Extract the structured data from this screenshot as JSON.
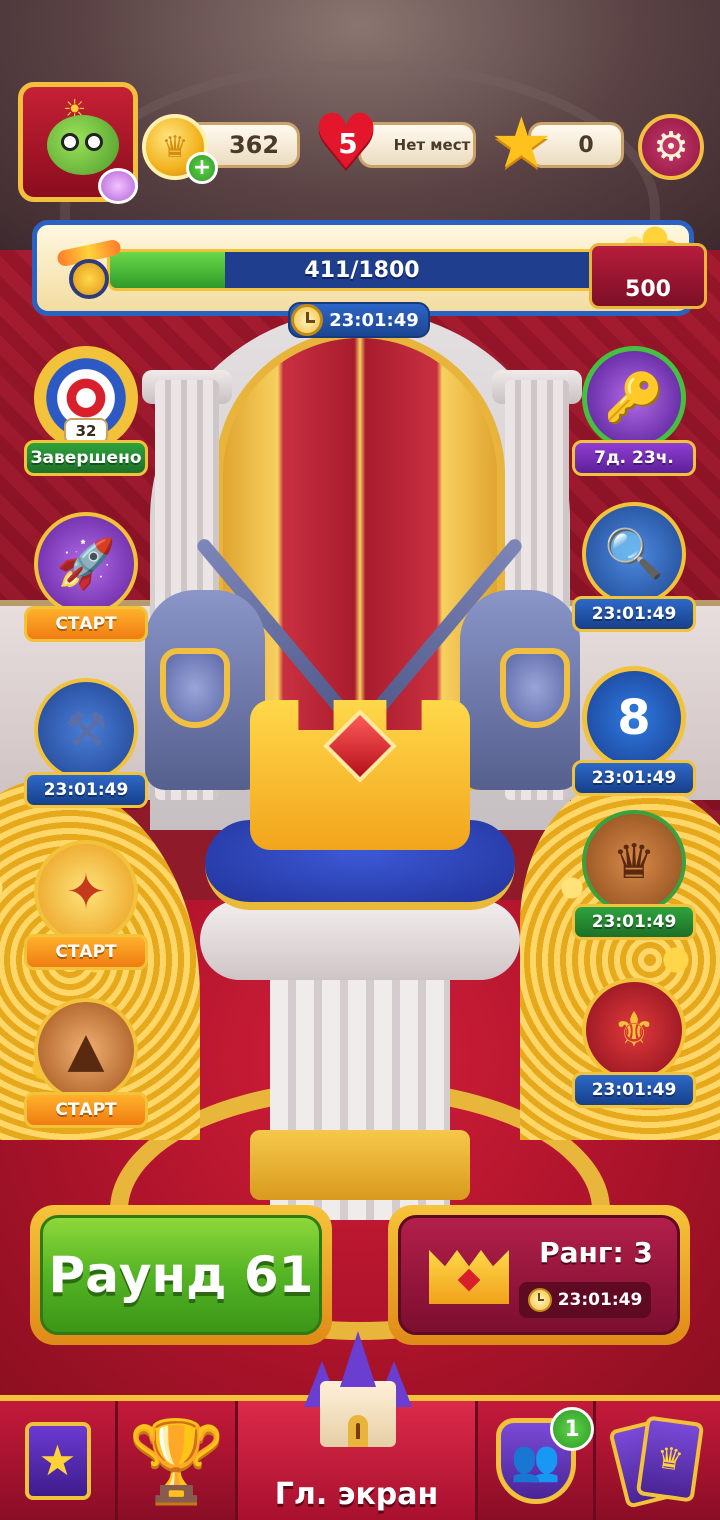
{
  "hud": {
    "coins": "362",
    "lives": "5",
    "lives_status": "Нет мест",
    "stars": "0",
    "coin_plus": "+",
    "settings_icon": "gear-icon"
  },
  "progress": {
    "text": "411/1800",
    "current": 411,
    "max": 1800,
    "reward": "500",
    "timer": "23:01:49"
  },
  "events_left": [
    {
      "id": "target",
      "label": "Завершено",
      "count": "32",
      "icon": "target-icon"
    },
    {
      "id": "rocket",
      "label": "СТАРТ",
      "icon": "rocket-icon"
    },
    {
      "id": "anvil",
      "label": "23:01:49",
      "icon": "anvil-icon"
    },
    {
      "id": "arch",
      "label": "СТАРТ",
      "icon": "golden-arch-icon"
    },
    {
      "id": "volcano",
      "label": "СТАРТ",
      "icon": "volcano-icon"
    }
  ],
  "events_right": [
    {
      "id": "key",
      "label": "7д. 23ч.",
      "icon": "key-icon"
    },
    {
      "id": "scroll",
      "label": "23:01:49",
      "icon": "magnifier-scroll-icon"
    },
    {
      "id": "shield",
      "label": "23:01:49",
      "value": "8",
      "icon": "shield-icon"
    },
    {
      "id": "chest",
      "label": "23:01:49",
      "icon": "chest-icon"
    },
    {
      "id": "crate",
      "label": "23:01:49",
      "icon": "crate-icon"
    }
  ],
  "play_button": {
    "label": "Раунд 61"
  },
  "rank_button": {
    "title": "Ранг: 3",
    "timer": "23:01:49"
  },
  "nav": {
    "home_label": "Гл. экран",
    "team_badge": "1"
  },
  "colors": {
    "accent_gold": "#f2c23a",
    "play_green": "#54b424",
    "nav_red": "#c41a3a",
    "banner_blue": "#2a62c4"
  }
}
